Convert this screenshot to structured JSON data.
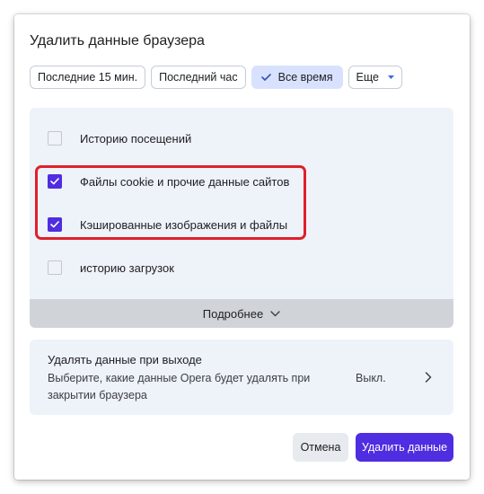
{
  "dialog": {
    "title": "Удалить данные браузера"
  },
  "time_range": {
    "options": [
      {
        "label": "Последние 15 мин.",
        "selected": false
      },
      {
        "label": "Последний час",
        "selected": false
      },
      {
        "label": "Все время",
        "selected": true
      }
    ],
    "more_label": "Еще"
  },
  "data_types": [
    {
      "label": "Историю посещений",
      "checked": false
    },
    {
      "label": "Файлы cookie и прочие данные сайтов",
      "checked": true
    },
    {
      "label": "Кэшированные изображения и файлы",
      "checked": true
    },
    {
      "label": "историю загрузок",
      "checked": false
    }
  ],
  "more_details": {
    "label": "Подробнее"
  },
  "clear_on_exit": {
    "title": "Удалять данные при выходе",
    "description": "Выберите, какие данные Opera будет удалять при закрытии браузера",
    "status": "Выкл."
  },
  "actions": {
    "cancel": "Отмена",
    "confirm": "Удалить данные"
  },
  "colors": {
    "accent": "#4f2de0",
    "selected_chip": "#d8e2ff",
    "panel_bg": "#eef2f9",
    "highlight": "#e0202a"
  },
  "icons": {
    "check": "check-icon",
    "caret": "caret-down-icon",
    "chevron_down": "chevron-down-icon",
    "chevron_right": "chevron-right-icon"
  }
}
